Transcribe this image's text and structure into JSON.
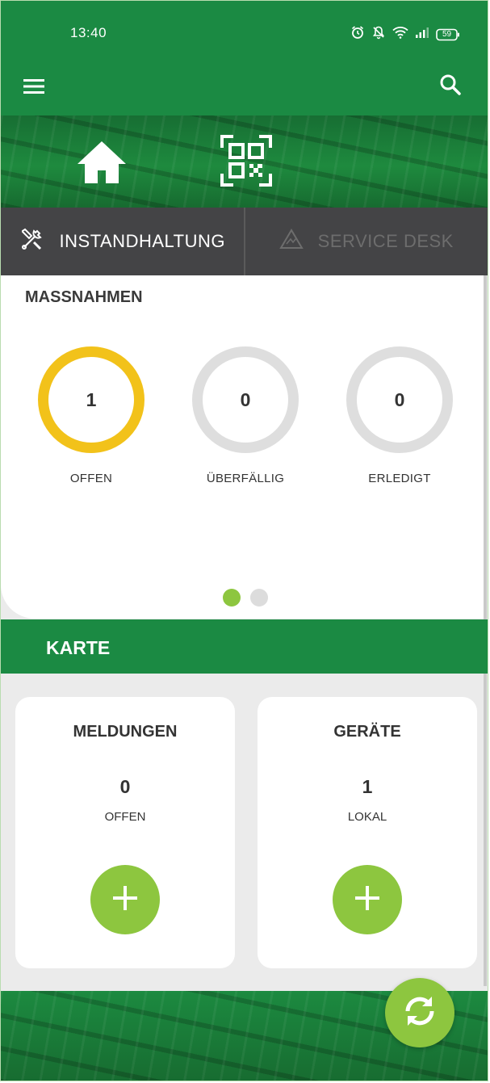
{
  "status_bar": {
    "time": "13:40",
    "battery": "59",
    "icons": [
      "alarm-icon",
      "bell-off-icon",
      "wifi-icon",
      "signal-icon",
      "battery-icon"
    ]
  },
  "app_bar": {
    "menu_icon": "hamburger-menu-icon",
    "search_icon": "search-icon"
  },
  "hero": {
    "home_icon": "home-icon",
    "qr_icon": "qr-scan-icon"
  },
  "tabs": [
    {
      "label": "INSTANDHALTUNG",
      "icon": "tools-icon",
      "active": true
    },
    {
      "label": "SERVICE DESK",
      "icon": "warning-icon",
      "active": false
    }
  ],
  "massnahmen": {
    "title": "MASSNAHMEN",
    "gauges": [
      {
        "value": "1",
        "label": "OFFEN"
      },
      {
        "value": "0",
        "label": "ÜBERFÄLLIG"
      },
      {
        "value": "0",
        "label": "ERLEDIGT"
      }
    ],
    "pager": {
      "pages": 2,
      "current": 1
    }
  },
  "karte": {
    "title": "KARTE"
  },
  "tiles": [
    {
      "title": "MELDUNGEN",
      "count": "0",
      "sub": "OFFEN",
      "button_icon": "plus-icon"
    },
    {
      "title": "GERÄTE",
      "count": "1",
      "sub": "LOKAL",
      "button_icon": "plus-icon"
    }
  ],
  "sync_button": {
    "icon": "sync-icon"
  },
  "colors": {
    "brand_green": "#1b8a43",
    "accent_lime": "#8dc63f",
    "gauge_active": "#f2c21a",
    "gauge_inactive": "#dedede",
    "tab_bar": "#444446"
  }
}
